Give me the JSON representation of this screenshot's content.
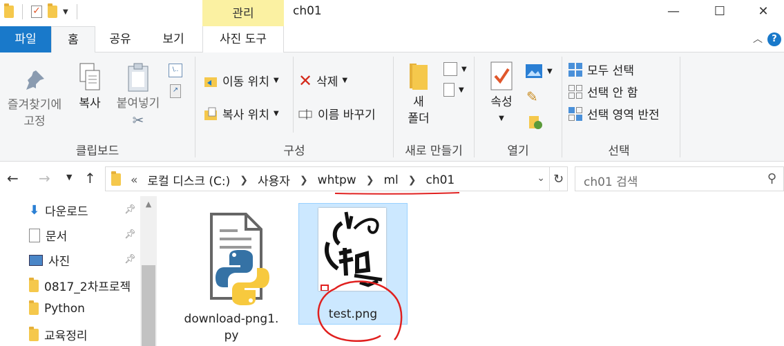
{
  "window": {
    "title": "ch01",
    "contextual_tab": "관리",
    "controls": {
      "minimize": "—",
      "maximize": "☐",
      "close": "✕"
    }
  },
  "ribbon_tabs": {
    "file": "파일",
    "home": "홈",
    "share": "공유",
    "view": "보기",
    "picture_tools": "사진 도구"
  },
  "ribbon": {
    "clipboard": {
      "label": "클립보드",
      "pin_quick": [
        "즐겨찾기에",
        "고정"
      ],
      "copy": "복사",
      "paste": "붙여넣기"
    },
    "organize": {
      "label": "구성",
      "move_to": "이동 위치",
      "copy_to": "복사 위치",
      "delete": "삭제",
      "rename": "이름 바꾸기"
    },
    "new": {
      "label": "새로 만들기",
      "new_folder": [
        "새",
        "폴더"
      ]
    },
    "open": {
      "label": "열기",
      "properties": "속성"
    },
    "select": {
      "label": "선택",
      "select_all": "모두 선택",
      "select_none": "선택 안 함",
      "invert": "선택 영역 반전"
    }
  },
  "address": {
    "overflow": "«",
    "crumbs": [
      "로컬 디스크 (C:)",
      "사용자",
      "whtpw",
      "ml",
      "ch01"
    ],
    "search_placeholder": "ch01 검색"
  },
  "navpane": {
    "items": [
      {
        "label": "다운로드",
        "icon": "download-arrow-icon",
        "pinned": true
      },
      {
        "label": "문서",
        "icon": "document-icon",
        "pinned": true
      },
      {
        "label": "사진",
        "icon": "picture-icon",
        "pinned": true
      },
      {
        "label": "0817_2차프로젝",
        "icon": "folder-icon",
        "pinned": false
      },
      {
        "label": "Python",
        "icon": "folder-icon",
        "pinned": false
      },
      {
        "label": "교육정리",
        "icon": "folder-icon",
        "pinned": false
      }
    ]
  },
  "files": [
    {
      "name": [
        "download-png1.",
        "py"
      ],
      "type": "python-file",
      "selected": false
    },
    {
      "name": [
        "test.png"
      ],
      "type": "image-file",
      "selected": true
    }
  ],
  "colors": {
    "accent": "#1979ca",
    "contextual_tab": "#fbf1a2",
    "selection": "#cce8ff",
    "annotation_red": "#e0201f"
  }
}
